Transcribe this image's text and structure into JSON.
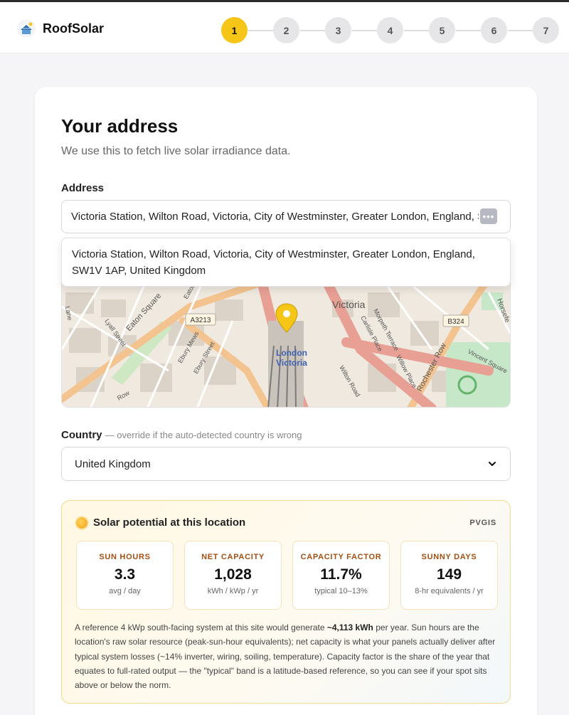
{
  "header": {
    "brand": "RoofSolar",
    "steps": [
      "1",
      "2",
      "3",
      "4",
      "5",
      "6",
      "7"
    ],
    "active_step": "1"
  },
  "address_section": {
    "title": "Your address",
    "subtitle": "We use this to fetch live solar irradiance data.",
    "address_label": "Address",
    "address_value": "Victoria Station, Wilton Road, Victoria, City of Westminster, Greater London, England, S",
    "suggestion": "Victoria Station, Wilton Road, Victoria, City of Westminster, Greater London, England, SW1V 1AP, United Kingdom",
    "more_icon": "ellipsis-icon"
  },
  "map": {
    "labels": {
      "victoria": "Victoria",
      "station": "London Victoria",
      "station_line1": "London",
      "station_line2": "Victoria",
      "a3213": "A3213",
      "b324": "B324",
      "eaton_square": "Eaton Square",
      "lyall_street": "Lyall Street",
      "ebury_mews": "Ebury Mews",
      "ebury_street": "Ebury Street",
      "rochester_row": "Rochester Row",
      "vincent_square": "Vincent Square",
      "wilton_road": "Wilton Road",
      "morpeth_terrace": "Morpeth Terrace",
      "carlisle_place": "Carlisle Place",
      "willow_place": "Willow Place",
      "horseferry": "Horsefe",
      "row": "Row",
      "eaton": "Eaton",
      "lane": "Lane"
    },
    "marker_icon": "location-pin-icon"
  },
  "country": {
    "label": "Country",
    "hint": "— override if the auto-detected country is wrong",
    "value": "United Kingdom"
  },
  "solar": {
    "title": "Solar potential at this location",
    "source": "PVGIS",
    "icon": "sun-icon",
    "stats": [
      {
        "label": "SUN HOURS",
        "value": "3.3",
        "unit": "avg / day"
      },
      {
        "label": "NET CAPACITY",
        "value": "1,028",
        "unit": "kWh / kWp / yr"
      },
      {
        "label": "CAPACITY FACTOR",
        "value": "11.7%",
        "unit": "typical 10–13%"
      },
      {
        "label": "SUNNY DAYS",
        "value": "149",
        "unit": "8-hr equivalents / yr"
      }
    ],
    "text_before": "A reference 4 kWp south-facing system at this site would generate ",
    "text_bold": "~4,113 kWh",
    "text_after": " per year. Sun hours are the location's raw solar resource (peak-sun-hour equivalents); net capacity is what your panels actually deliver after typical system losses (~14% inverter, wiring, soiling, temperature). Capacity factor is the share of the year that equates to full-rated output — the \"typical\" band is a latitude-based reference, so you can see if your spot sits above or below the norm."
  },
  "colors": {
    "accent": "#f5c518",
    "step_inactive": "#e6e6e8",
    "stat_label": "#a34f12",
    "panel_border": "#f3d98a"
  }
}
